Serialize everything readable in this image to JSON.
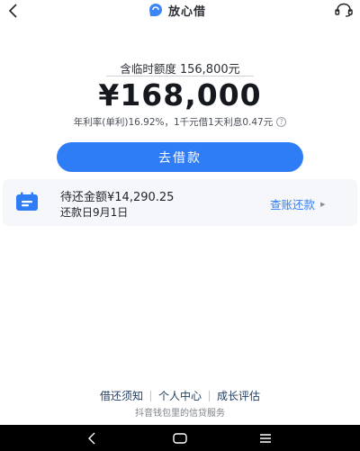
{
  "header": {
    "brand_name": "放心借"
  },
  "main": {
    "temp_limit_prefix": "含临时额度",
    "temp_limit_value": "156,800元",
    "amount": "¥168,000",
    "rate_text": "年利率(单利)16.92%，1千元借1天利息0.47元",
    "borrow_button": "去借款"
  },
  "repayment": {
    "amount_text": "待还金额¥14,290.25",
    "date_text": "还款日9月1日",
    "view_bill_label": "查账还款"
  },
  "footer": {
    "links": [
      "借还须知",
      "个人中心",
      "成长评估"
    ],
    "note": "抖音钱包里的信贷服务"
  },
  "colors": {
    "accent": "#2f7df6",
    "card_bg": "#f5f7fa"
  },
  "icons": {
    "back": "back-arrow-icon",
    "logo": "brand-logo-icon",
    "support": "headset-icon",
    "calendar": "calendar-icon",
    "help": "question-circle-icon"
  }
}
